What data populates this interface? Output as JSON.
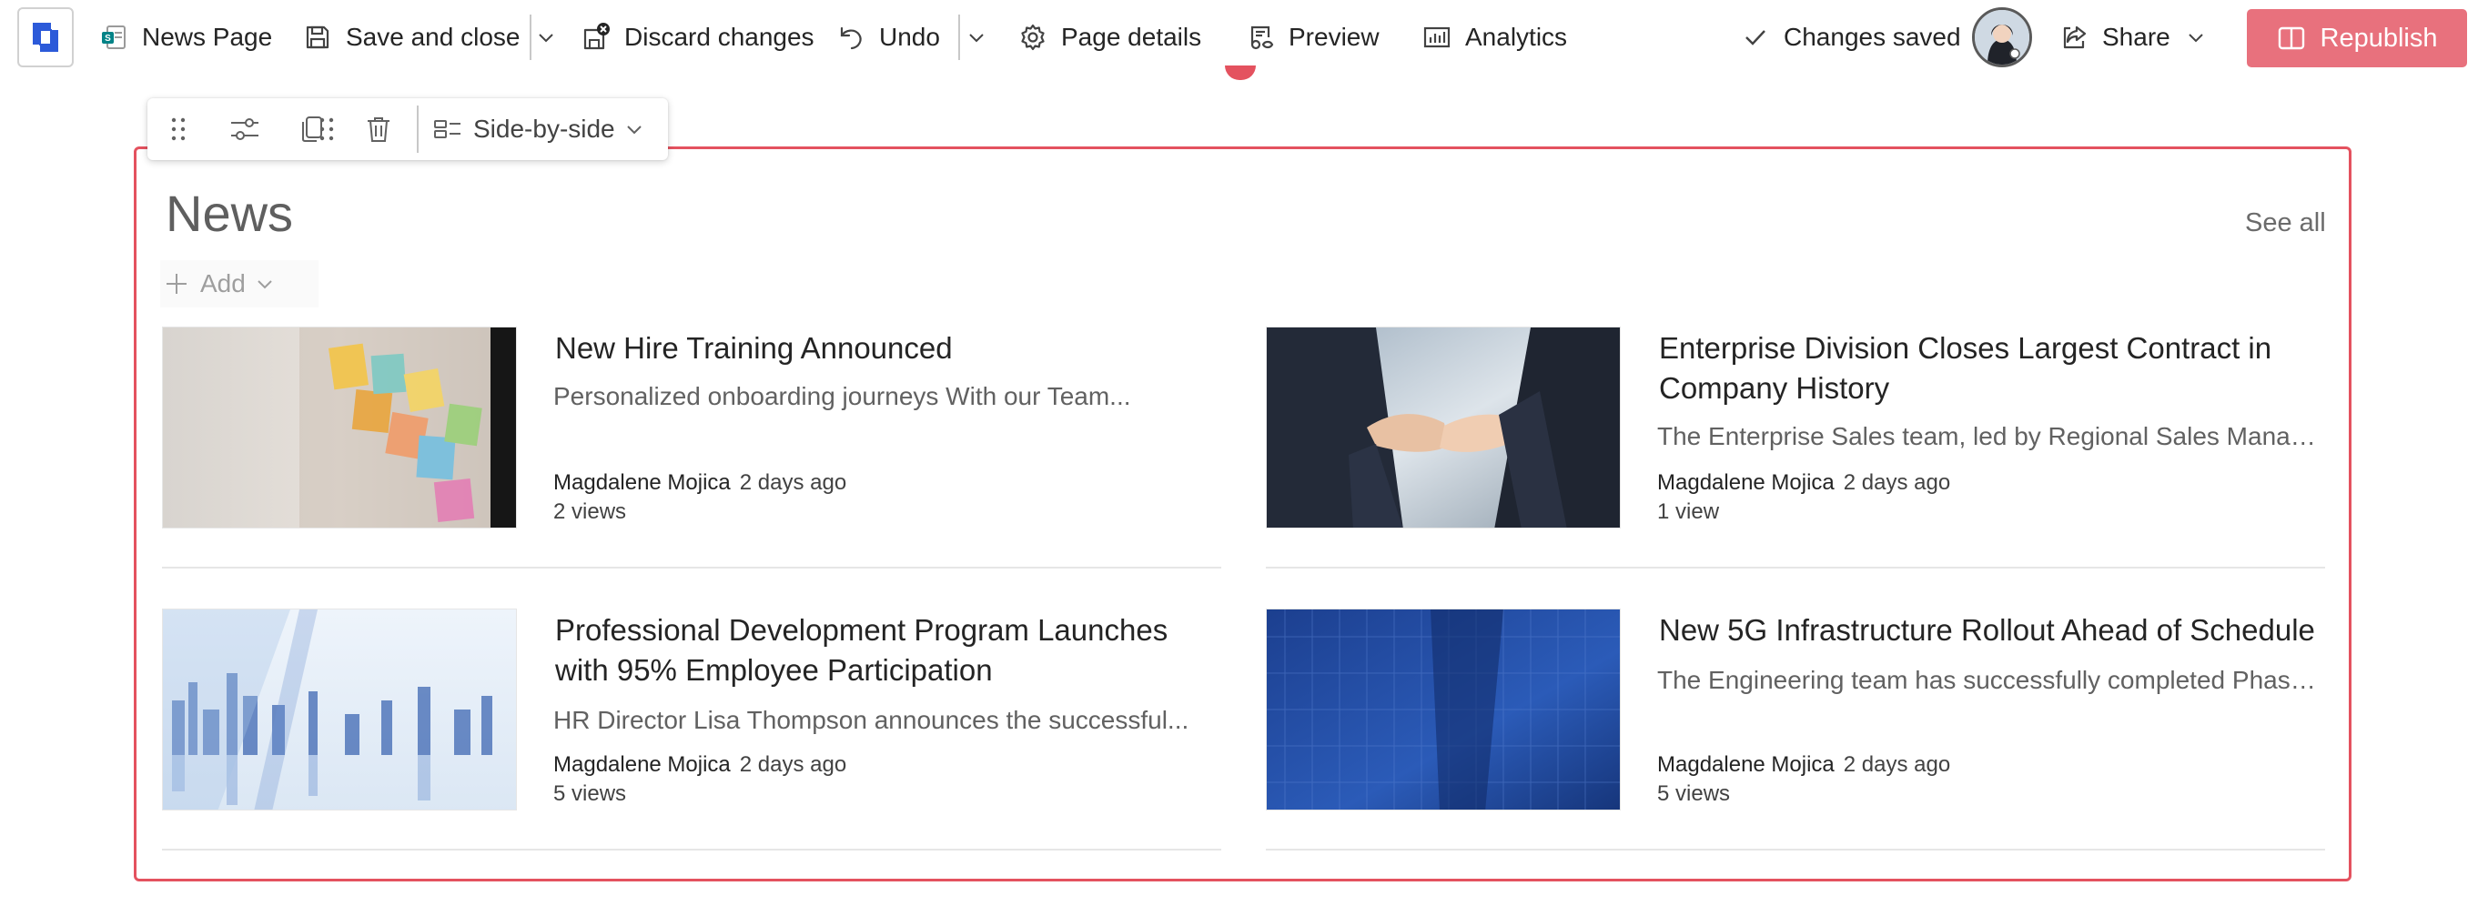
{
  "toolbar": {
    "page_name": "News Page",
    "save_close": "Save and close",
    "discard": "Discard changes",
    "undo": "Undo",
    "page_details": "Page details",
    "preview": "Preview",
    "analytics": "Analytics",
    "status": "Changes saved",
    "share": "Share",
    "republish": "Republish"
  },
  "webpart_toolbar": {
    "layout": "Side-by-side"
  },
  "news": {
    "title": "News",
    "see_all": "See all",
    "add": "Add",
    "items": [
      {
        "title": "New Hire Training Announced",
        "description": "Personalized onboarding journeys With our Team...",
        "author": "Magdalene Mojica",
        "date": "2 days ago",
        "views": "2 views",
        "thumbnail": "sticky-notes-image"
      },
      {
        "title": "Enterprise Division Closes Largest Contract in Company History",
        "description": "The Enterprise Sales team, led by Regional Sales Manager...",
        "author": "Magdalene Mojica",
        "date": "2 days ago",
        "views": "1 view",
        "thumbnail": "handshake-image"
      },
      {
        "title": "Professional Development Program Launches with 95% Employee Participation",
        "description": "HR Director Lisa Thompson announces the successful...",
        "author": "Magdalene Mojica",
        "date": "2 days ago",
        "views": "5 views",
        "thumbnail": "city-skyline-image"
      },
      {
        "title": "New 5G Infrastructure Rollout Ahead of Schedule",
        "description": "The Engineering team has successfully completed Phase ...",
        "author": "Magdalene Mojica",
        "date": "2 days ago",
        "views": "5 views",
        "thumbnail": "glass-building-image"
      }
    ]
  },
  "colors": {
    "accent": "#e4525f",
    "republish_bg": "#e8717d",
    "text": "#242424",
    "muted": "#616161"
  }
}
